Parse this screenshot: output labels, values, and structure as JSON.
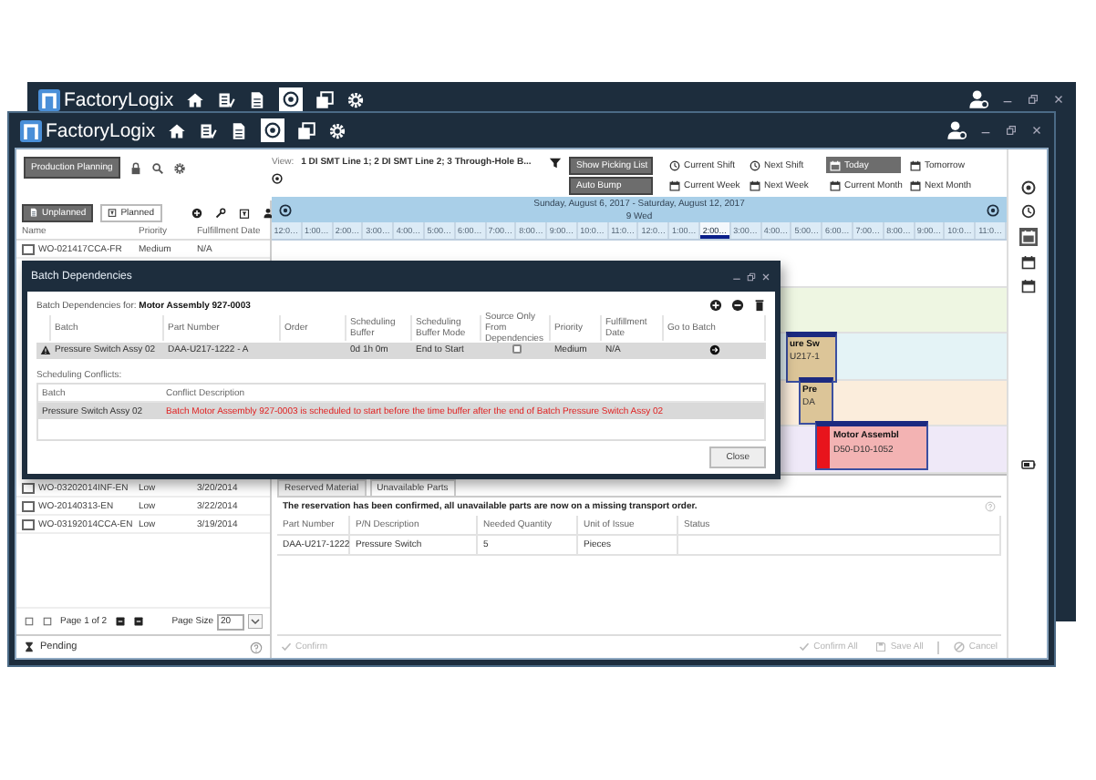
{
  "back_window": {
    "title": "FactoryLogix"
  },
  "window": {
    "title": "FactoryLogix"
  },
  "toolbar": {
    "module": "Production Planning",
    "view_label": "View:",
    "view": "1 DI SMT Line 1; 2 DI SMT Line 2; 3 Through-Hole B...",
    "toggles": [
      {
        "label": "Show Picking List",
        "on": true
      },
      {
        "label": "Auto Bump",
        "on": true
      }
    ],
    "ranges": [
      {
        "label": "Current Shift",
        "selected": false
      },
      {
        "label": "Current Week",
        "selected": false
      },
      {
        "label": "Next Shift",
        "selected": false
      },
      {
        "label": "Next Week",
        "selected": false
      },
      {
        "label": "Today",
        "selected": true
      },
      {
        "label": "Current Month",
        "selected": false
      },
      {
        "label": "Tomorrow",
        "selected": false
      },
      {
        "label": "Next Month",
        "selected": false
      }
    ]
  },
  "work_orders": {
    "tabs": [
      {
        "label": "Unplanned",
        "selected": true
      },
      {
        "label": "Planned",
        "selected": false
      }
    ],
    "columns": [
      "Name",
      "Priority",
      "Fulfillment Date"
    ],
    "rows_above_dialog": [
      {
        "name": "WO-021417CCA-FR",
        "priority": "Medium",
        "date": "N/A",
        "checked": false
      }
    ],
    "rows_below_dialog": [
      {
        "name": "WO-03202014INF-EN",
        "priority": "Low",
        "date": "3/20/2014",
        "checked": false
      },
      {
        "name": "WO-20140313-EN",
        "priority": "Low",
        "date": "3/22/2014",
        "checked": false
      },
      {
        "name": "WO-03192014CCA-EN",
        "priority": "Low",
        "date": "3/19/2014",
        "checked": false
      }
    ],
    "pager": {
      "label": "Page 1 of 2",
      "page_size_label": "Page Size",
      "page_size": "20"
    },
    "pending": "Pending"
  },
  "schedule": {
    "range": "Sunday, August 6, 2017 - Saturday, August 12, 2017",
    "day": "9 Wed",
    "hours": [
      {
        "label": "12:0…",
        "selected": false
      },
      {
        "label": "1:00…",
        "selected": false
      },
      {
        "label": "2:00…",
        "selected": false
      },
      {
        "label": "3:00…",
        "selected": false
      },
      {
        "label": "4:00…",
        "selected": false
      },
      {
        "label": "5:00…",
        "selected": false
      },
      {
        "label": "6:00…",
        "selected": false
      },
      {
        "label": "7:00…",
        "selected": false
      },
      {
        "label": "8:00…",
        "selected": false
      },
      {
        "label": "9:00…",
        "selected": false
      },
      {
        "label": "10:0…",
        "selected": false
      },
      {
        "label": "11:0…",
        "selected": false
      },
      {
        "label": "12:0…",
        "selected": false
      },
      {
        "label": "1:00…",
        "selected": false
      },
      {
        "label": "2:00…",
        "selected": true
      },
      {
        "label": "3:00…",
        "selected": false
      },
      {
        "label": "4:00…",
        "selected": false
      },
      {
        "label": "5:00…",
        "selected": false
      },
      {
        "label": "6:00…",
        "selected": false
      },
      {
        "label": "7:00…",
        "selected": false
      },
      {
        "label": "8:00…",
        "selected": false
      },
      {
        "label": "9:00…",
        "selected": false
      },
      {
        "label": "10:0…",
        "selected": false
      },
      {
        "label": "11:0…",
        "selected": false
      }
    ],
    "lanes": [
      {
        "color": "#ffffff"
      },
      {
        "color": "#eef6e2"
      },
      {
        "color": "#e4f3f6"
      },
      {
        "color": "#fbeddc"
      },
      {
        "color": "#efe9f8"
      }
    ],
    "bars": [
      {
        "title": "ure Sw",
        "part": "U217-1",
        "color": "#dcc598"
      },
      {
        "title": "Pre",
        "part": "DA",
        "color": "#dcc598"
      },
      {
        "title": "Motor Assembl",
        "part": "D50-D10-1052",
        "color": "#f3b3b3"
      }
    ]
  },
  "details": {
    "tabs": [
      {
        "label": "Reserved Material",
        "selected": false
      },
      {
        "label": "Unavailable Parts",
        "selected": true
      }
    ],
    "message": "The reservation has been confirmed, all unavailable parts are now on a missing transport order.",
    "columns": [
      "Part Number",
      "P/N Description",
      "Needed Quantity",
      "Unit of Issue",
      "Status"
    ],
    "rows": [
      {
        "cells": [
          "DAA-U217-1222",
          "Pressure Switch",
          "5",
          "Pieces"
        ]
      }
    ],
    "left_actions": [
      {
        "label": "Confirm",
        "disabled": true
      }
    ],
    "right_actions": [
      {
        "label": "Confirm All",
        "disabled": true
      },
      {
        "label": "Save All",
        "disabled": true
      },
      {
        "label": "Cancel",
        "disabled": true
      }
    ]
  },
  "dialog": {
    "title": "Batch Dependencies",
    "subtitle_label": "Batch Dependencies for:",
    "subtitle": "Motor Assembly 927-0003",
    "columns": [
      "Batch",
      "Part Number",
      "Order",
      "Scheduling Buffer",
      "Scheduling Buffer Mode",
      "Source Only From Dependencies",
      "Priority",
      "Fulfillment Date",
      "Go to Batch"
    ],
    "rows": [
      {
        "warning": true,
        "selected": true,
        "batch": "Pressure Switch Assy 02",
        "part": "DAA-U217-1222 - A",
        "buffer": "0d 1h 0m",
        "mode": "End to Start",
        "source_only": false,
        "priority": "Medium",
        "date": "N/A"
      }
    ],
    "conflicts_label": "Scheduling Conflicts:",
    "conflict_columns": [
      "Batch",
      "Conflict Description"
    ],
    "conflicts": [
      {
        "selected": true,
        "batch": "Pressure Switch Assy 02",
        "description": "Batch Motor Assembly 927-0003 is scheduled to start before the time buffer after the end of Batch Pressure Switch Assy 02"
      }
    ],
    "close": "Close"
  }
}
